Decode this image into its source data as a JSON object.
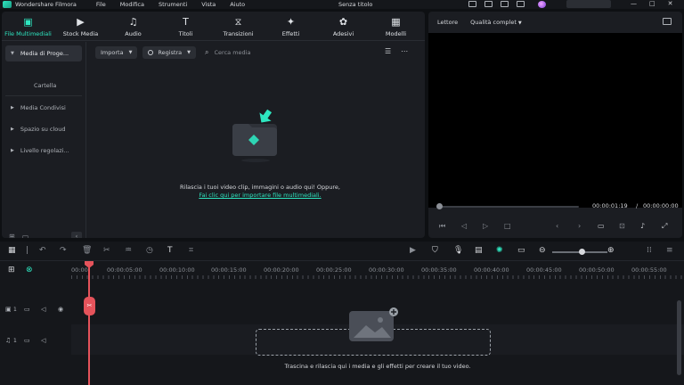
{
  "window": {
    "app_name": "Wondershare Filmora",
    "doc_title": "Senza titolo",
    "menu": [
      "File",
      "Modifica",
      "Strumenti",
      "Vista",
      "Aiuto"
    ],
    "controls": [
      "—",
      "□",
      "✕"
    ]
  },
  "media_tabs": [
    {
      "label": "File Multimediali",
      "icon": "folder-media-icon",
      "glyph": "▣",
      "active": true
    },
    {
      "label": "Stock Media",
      "icon": "stock-media-icon",
      "glyph": "▶",
      "active": false
    },
    {
      "label": "Audio",
      "icon": "music-note-icon",
      "glyph": "♫",
      "active": false
    },
    {
      "label": "Titoli",
      "icon": "text-title-icon",
      "glyph": "T",
      "active": false
    },
    {
      "label": "Transizioni",
      "icon": "transition-icon",
      "glyph": "⧖",
      "active": false
    },
    {
      "label": "Effetti",
      "icon": "effects-icon",
      "glyph": "✦",
      "active": false
    },
    {
      "label": "Adesivi",
      "icon": "sticker-icon",
      "glyph": "✿",
      "active": false
    },
    {
      "label": "Modelli",
      "icon": "templates-icon",
      "glyph": "▦",
      "active": false
    }
  ],
  "sidebar": {
    "items": [
      {
        "label": "Media di Proge...",
        "active": true
      },
      {
        "label": "Media Condivisi",
        "active": false
      },
      {
        "label": "Spazio su cloud",
        "active": false
      },
      {
        "label": "Livello regolazi...",
        "active": false
      }
    ],
    "sub_item": "Cartella",
    "collapse_glyph": "‹"
  },
  "media_toolbar": {
    "import_label": "Importa",
    "record_label": "Registra",
    "search_placeholder": "Cerca media"
  },
  "drop_area": {
    "line1": "Rilascia i tuoi video clip, immagini o audio qui! Oppure,",
    "link": "Fai clic qui per importare file multimediali."
  },
  "player": {
    "label": "Lettore",
    "quality": "Qualità complet",
    "current_time": "00:00:01:19",
    "separator": "/",
    "total_time": "00:00:00:00",
    "scrub_fraction": 0.0
  },
  "timeline": {
    "ruler_labels": [
      "00:00",
      "00:00:05:00",
      "00:00:10:00",
      "00:00:15:00",
      "00:00:20:00",
      "00:00:25:00",
      "00:00:30:00",
      "00:00:35:00",
      "00:00:40:00",
      "00:00:45:00",
      "00:00:50:00",
      "00:00:55:00"
    ],
    "video_track_num": "1",
    "audio_track_num": "1",
    "drop_hint": "Trascina e rilascia qui i media e gli effetti per creare il tuo video.",
    "zoom_level": 0.5
  },
  "colors": {
    "accent": "#2ee6c0",
    "playhead": "#e5535b",
    "panel": "#1b1d22",
    "background": "#0e1013"
  }
}
